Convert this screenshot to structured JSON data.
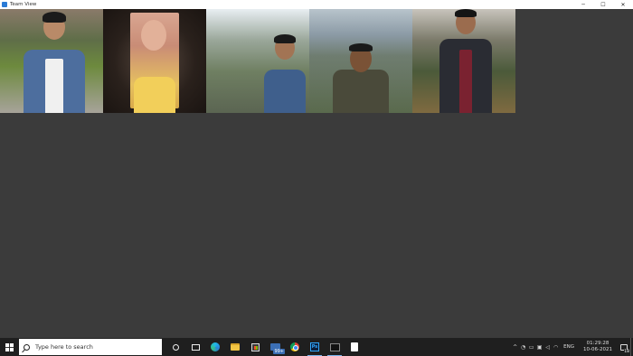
{
  "window": {
    "title": "Team View",
    "minimize": "─",
    "maximize": "☐",
    "close": "✕"
  },
  "photos": [
    {
      "name": "team-member-1"
    },
    {
      "name": "team-member-2"
    },
    {
      "name": "team-member-3"
    },
    {
      "name": "team-member-4"
    },
    {
      "name": "team-member-5"
    }
  ],
  "taskbar": {
    "search_placeholder": "Type here to search",
    "mail_badge": "99+",
    "ps_label": "Ps",
    "tray_chevron": "^",
    "language": "ENG",
    "time": "01:29:28",
    "date": "10-06-2021",
    "notification_count": "18"
  }
}
